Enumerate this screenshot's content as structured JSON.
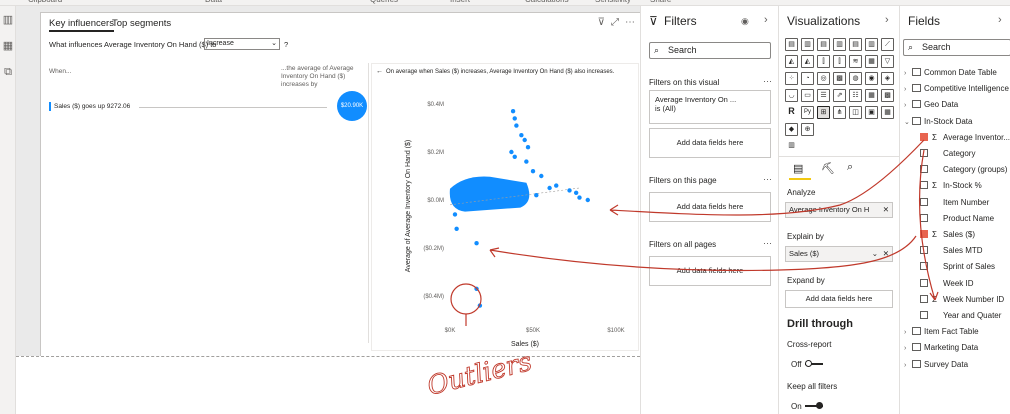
{
  "ribbon": {
    "items": [
      "Clipboard",
      "Data",
      "Queries",
      "Insert",
      "Calculations",
      "Sensitivity",
      "Share"
    ]
  },
  "visual": {
    "tabs": [
      "Key influencers",
      "Top segments"
    ],
    "question_prefix": "What influences Average Inventory On Hand ($) to",
    "question_select": "Increase",
    "question_help": "?",
    "when_label": "When...",
    "avg_label": "...the average of Average Inventory On Hand ($) increases by",
    "influencer_text": "Sales ($) goes up 9272.06",
    "influencer_value": "$20.90K",
    "back_arrow": "←",
    "scatter_message": "On average when Sales ($) increases, Average Inventory On Hand ($) also increases."
  },
  "chart_data": {
    "type": "scatter",
    "title": "",
    "xlabel": "Sales ($)",
    "ylabel": "Average of Average Inventory On Hand ($)",
    "x_ticks": [
      "$0K",
      "$50K",
      "$100K"
    ],
    "y_ticks": [
      "$0.4M",
      "$0.2M",
      "$0.0M",
      "($0.2M)",
      "($0.4M)"
    ],
    "xlim": [
      0,
      100000
    ],
    "ylim": [
      -0.5,
      0.45
    ],
    "cluster": {
      "x_range": [
        0,
        40000
      ],
      "y_range": [
        -0.04,
        0.08
      ]
    },
    "points": [
      {
        "x": 38000,
        "y": 0.37
      },
      {
        "x": 39000,
        "y": 0.34
      },
      {
        "x": 40000,
        "y": 0.31
      },
      {
        "x": 43000,
        "y": 0.27
      },
      {
        "x": 45000,
        "y": 0.25
      },
      {
        "x": 47000,
        "y": 0.22
      },
      {
        "x": 37000,
        "y": 0.2
      },
      {
        "x": 39000,
        "y": 0.18
      },
      {
        "x": 46000,
        "y": 0.16
      },
      {
        "x": 50000,
        "y": 0.12
      },
      {
        "x": 55000,
        "y": 0.1
      },
      {
        "x": 60000,
        "y": 0.05
      },
      {
        "x": 64000,
        "y": 0.06
      },
      {
        "x": 72000,
        "y": 0.04
      },
      {
        "x": 76000,
        "y": 0.03
      },
      {
        "x": 78000,
        "y": 0.01
      },
      {
        "x": 83000,
        "y": 0.0
      },
      {
        "x": 52000,
        "y": 0.02
      },
      {
        "x": 3000,
        "y": -0.06
      },
      {
        "x": 4000,
        "y": -0.12
      },
      {
        "x": 16000,
        "y": -0.18
      },
      {
        "x": 16000,
        "y": -0.37
      },
      {
        "x": 18000,
        "y": -0.44
      }
    ],
    "grid": false,
    "color": "#118dff"
  },
  "filters": {
    "title": "Filters",
    "search_placeholder": "Search",
    "on_visual_title": "Filters on this visual",
    "filter_card_line1": "Average Inventory On ...",
    "filter_card_line2": "is (All)",
    "add_fields": "Add data fields here",
    "on_page_title": "Filters on this page",
    "on_all_title": "Filters on all pages"
  },
  "viz": {
    "title": "Visualizations",
    "icons": [
      "stacked-bar",
      "stacked-column",
      "clustered-bar",
      "clustered-column",
      "100-bar",
      "100-column",
      "line",
      "area",
      "stacked-area",
      "line-column",
      "line-clustered",
      "ribbon",
      "waterfall",
      "funnel",
      "scatter",
      "pie",
      "donut",
      "treemap",
      "map",
      "filled-map",
      "shape-map",
      "gauge",
      "card",
      "multi-card",
      "kpi",
      "slicer",
      "table",
      "matrix",
      "r-visual",
      "python-visual",
      "key-influencers",
      "decomposition-tree",
      "qa",
      "smart-narrative",
      "paginated",
      "arcgis",
      "power-apps"
    ],
    "r_label": "R",
    "py_label": "Py",
    "analyze_label": "Analyze",
    "analyze_value": "Average Inventory On H",
    "explain_label": "Explain by",
    "explain_value": "Sales ($)",
    "expand_label": "Expand by",
    "expand_add": "Add data fields here",
    "drill_title": "Drill through",
    "cross_report": "Cross-report",
    "off_label": "Off",
    "keep_filters": "Keep all filters",
    "on_label": "On"
  },
  "fields": {
    "title": "Fields",
    "search_placeholder": "Search",
    "tables": [
      "Common Date Table",
      "Competitive Intelligence",
      "Geo Data",
      "In-Stock Data"
    ],
    "instock_fields": [
      {
        "label": "Average Inventor...",
        "checked": true,
        "sigma": true
      },
      {
        "label": "Category",
        "checked": false,
        "sigma": false
      },
      {
        "label": "Category (groups)",
        "checked": false,
        "sigma": false
      },
      {
        "label": "In-Stock %",
        "checked": false,
        "sigma": true
      },
      {
        "label": "Item Number",
        "checked": false,
        "sigma": false
      },
      {
        "label": "Product Name",
        "checked": false,
        "sigma": false
      },
      {
        "label": "Sales ($)",
        "checked": true,
        "sigma": true
      },
      {
        "label": "Sales MTD",
        "checked": false,
        "sigma": false
      },
      {
        "label": "Sprint of Sales",
        "checked": false,
        "sigma": false
      },
      {
        "label": "Week ID",
        "checked": false,
        "sigma": false
      },
      {
        "label": "Week Number ID",
        "checked": false,
        "sigma": true
      },
      {
        "label": "Year and Quater",
        "checked": false,
        "sigma": false
      }
    ],
    "tables_after": [
      "Item Fact Table",
      "Marketing Data",
      "Survey Data"
    ]
  },
  "annotation": {
    "text": "Outliers",
    "color": "#c0392b"
  }
}
